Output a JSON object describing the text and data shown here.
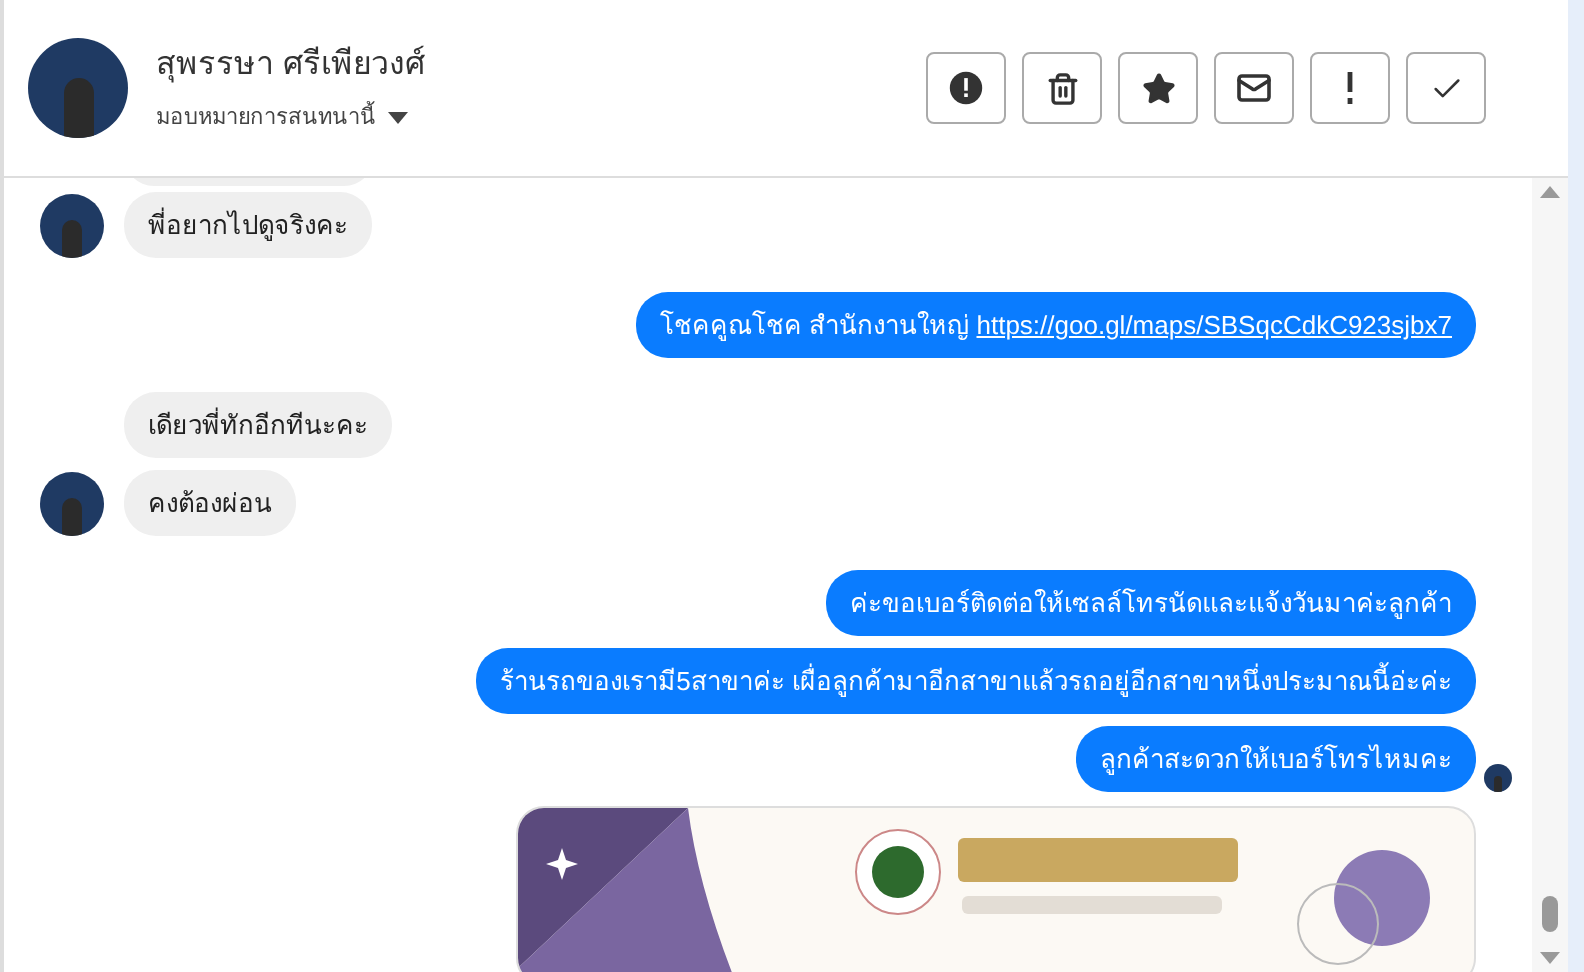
{
  "contact": {
    "name": "สุพรรษา ศรีเพียวงศ์",
    "assign_label": "มอบหมายการสนทนานี้"
  },
  "header_actions": [
    {
      "kind": "alert"
    },
    {
      "kind": "trash"
    },
    {
      "kind": "star"
    },
    {
      "kind": "mail"
    },
    {
      "kind": "exclaim"
    },
    {
      "kind": "check"
    }
  ],
  "messages": [
    {
      "kind": "incoming",
      "text": "พี่อยากไปดูจริงคะ",
      "avatar": true
    },
    {
      "kind": "outlink",
      "text": "โชคคูณโชค สำนักงานใหญ่",
      "link": "https://goo.gl/maps/SBSqcCdkC923sjbx7",
      "avatar": false
    },
    {
      "kind": "incoming",
      "text": "เดียวพี่ทักอีกทีนะคะ",
      "avatar": false
    },
    {
      "kind": "incoming",
      "text": "คงต้องผ่อน",
      "avatar": true
    },
    {
      "kind": "outgoing",
      "text": "ค่ะขอเบอร์ติดต่อให้เซลล์โทรนัดและแจ้งวันมาค่ะลูกค้า",
      "avatar": false
    },
    {
      "kind": "outgoing",
      "text": "ร้านรถของเรามี5สาขาค่ะ เผื่อลูกค้ามาอีกสาขาแล้วรถอยู่อีกสาขาหนึ่งประมาณนี้อ่ะค่ะ",
      "avatar": false
    },
    {
      "kind": "outgoing",
      "text": "ลูกค้าสะดวกให้เบอร์โทรไหมคะ",
      "avatar": true
    },
    {
      "kind": "outimage",
      "avatar": false
    }
  ]
}
